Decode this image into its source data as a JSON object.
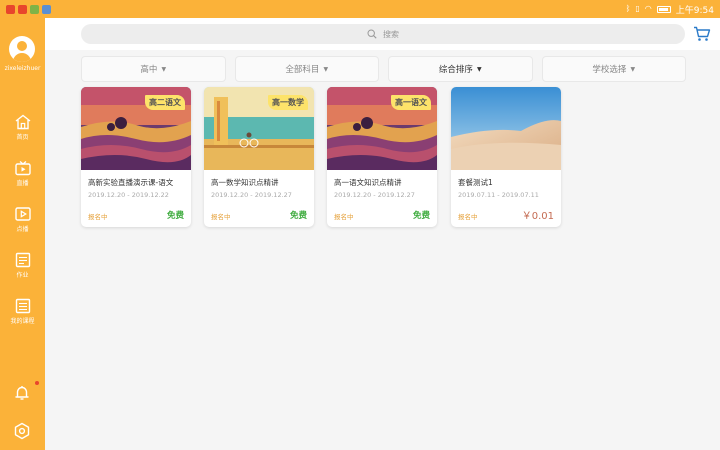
{
  "status_bar": {
    "time": "上午9:54",
    "notif_colors": [
      "#e8452c",
      "#e8452c",
      "#7fb347",
      "#5b8fd1"
    ]
  },
  "sidebar": {
    "username": "zixeleizhuer",
    "items": [
      {
        "label": "首页",
        "icon": "home-icon"
      },
      {
        "label": "直播",
        "icon": "tv-icon"
      },
      {
        "label": "点播",
        "icon": "play-icon"
      },
      {
        "label": "作业",
        "icon": "homework-icon"
      },
      {
        "label": "我的课程",
        "icon": "courses-icon"
      }
    ]
  },
  "search": {
    "placeholder": "搜索"
  },
  "filters": [
    {
      "label": "高中"
    },
    {
      "label": "全部科目"
    },
    {
      "label": "综合排序"
    },
    {
      "label": "学校选择"
    }
  ],
  "cards": [
    {
      "badge": "高二语文",
      "title": "高新实验直播演示课-语文",
      "dates": "2019.12.20 - 2019.12.22",
      "status": "报名中",
      "price": "免费"
    },
    {
      "badge": "高一数学",
      "title": "高一数学知识点精讲",
      "dates": "2019.12.20 - 2019.12.27",
      "status": "报名中",
      "price": "免费"
    },
    {
      "badge": "高一语文",
      "title": "高一语文知识点精讲",
      "dates": "2019.12.20 - 2019.12.27",
      "status": "报名中",
      "price": "免费"
    },
    {
      "badge": "",
      "title": "套餐测试1",
      "dates": "2019.07.11 - 2019.07.11",
      "status": "报名中",
      "price": "￥0.01"
    }
  ],
  "colors": {
    "accent": "#fbb239",
    "free": "#3dab3d",
    "paid": "#c46b52",
    "status": "#e6a23c"
  }
}
